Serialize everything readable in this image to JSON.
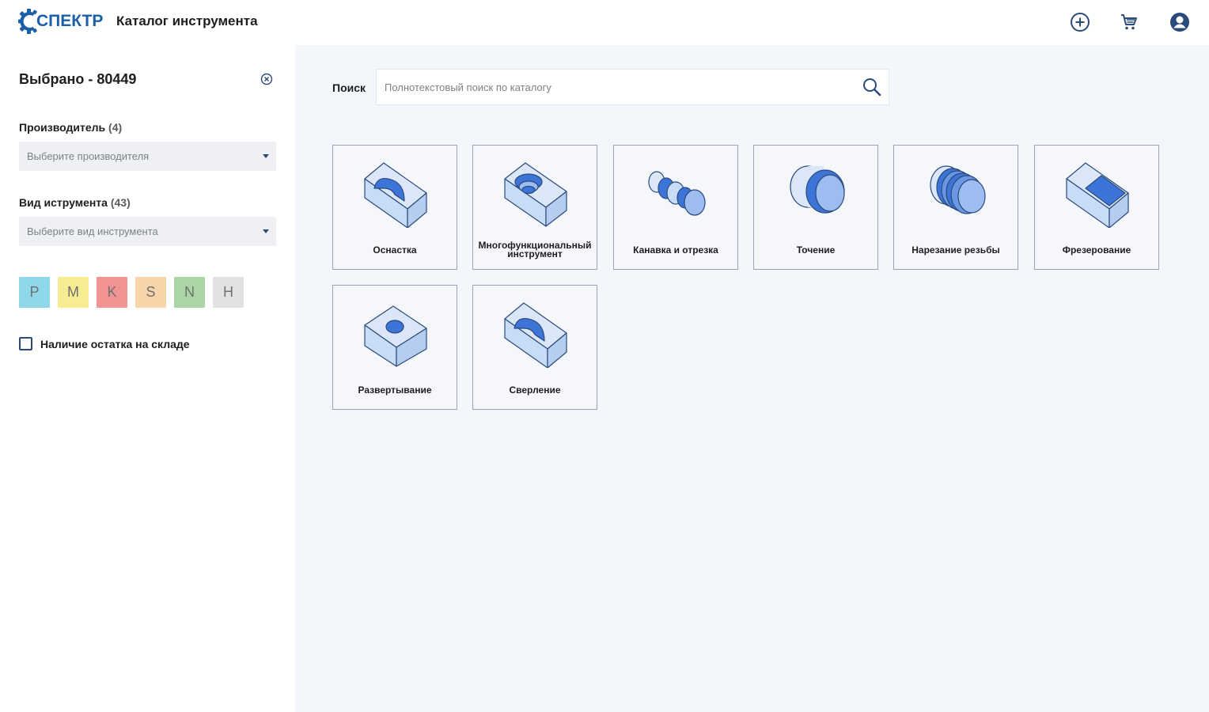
{
  "header": {
    "logo_text": "СПЕКТР",
    "title": "Каталог инструмента",
    "icons": [
      "add-circle-icon",
      "cart-icon",
      "user-account-icon"
    ]
  },
  "sidebar": {
    "selected_label": "Выбрано - 80449",
    "manufacturer": {
      "label": "Производитель",
      "count": "(4)",
      "placeholder": "Выберите производителя"
    },
    "tool_type": {
      "label": "Вид иструмента",
      "count": "(43)",
      "placeholder": "Выберите вид инструмента"
    },
    "materials": [
      {
        "code": "P",
        "color": "#8fd8ec"
      },
      {
        "code": "M",
        "color": "#f6ec92"
      },
      {
        "code": "K",
        "color": "#f19393"
      },
      {
        "code": "S",
        "color": "#f7d4aa"
      },
      {
        "code": "N",
        "color": "#a9d6a4"
      },
      {
        "code": "H",
        "color": "#e2e2e2"
      }
    ],
    "stock_label": "Наличие остатка на складе",
    "stock_checked": false
  },
  "search": {
    "label": "Поиск",
    "placeholder": "Полнотекстовый поиск по каталогу",
    "value": ""
  },
  "categories": [
    {
      "label": "Оснастка",
      "icon": "fixture-block-icon"
    },
    {
      "label": "Многофункциональный инструмент",
      "icon": "multifunction-tool-icon"
    },
    {
      "label": "Канавка и отрезка",
      "icon": "grooving-cutoff-icon"
    },
    {
      "label": "Точение",
      "icon": "turning-icon"
    },
    {
      "label": "Нарезание резьбы",
      "icon": "threading-icon"
    },
    {
      "label": "Фрезерование",
      "icon": "milling-icon"
    },
    {
      "label": "Развертывание",
      "icon": "reaming-icon"
    },
    {
      "label": "Сверление",
      "icon": "drilling-icon"
    }
  ],
  "colors": {
    "accent": "#1b5fa8",
    "icon_light": "#c9dcf7",
    "icon_dark": "#3d74d8",
    "outline": "#2a4a7a"
  }
}
